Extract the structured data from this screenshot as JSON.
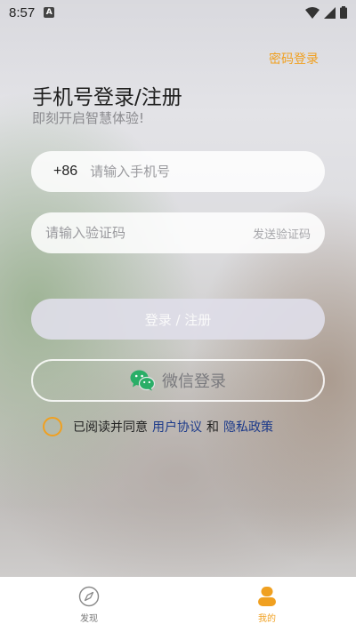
{
  "status_bar": {
    "time": "8:57",
    "notification_badge": "A",
    "icons": [
      "wifi-icon",
      "signal-icon",
      "battery-icon"
    ]
  },
  "header": {
    "password_login_label": "密码登录",
    "title": "手机号登录/注册",
    "subtitle": "即刻开启智慧体验!"
  },
  "form": {
    "country_code": "+86",
    "phone_placeholder": "请输入手机号",
    "phone_value": "",
    "code_placeholder": "请输入验证码",
    "code_value": "",
    "send_code_label": "发送验证码",
    "login_button_label": "登录 / 注册",
    "wechat_login_label": "微信登录"
  },
  "agreement": {
    "checked": false,
    "prefix_text": "已阅读并同意",
    "user_agreement_label": "用户协议",
    "and_text": "和",
    "privacy_policy_label": "隐私政策"
  },
  "tabbar": {
    "tabs": [
      {
        "label": "发现",
        "icon": "compass-icon",
        "active": false
      },
      {
        "label": "我的",
        "icon": "user-icon",
        "active": true
      }
    ]
  },
  "colors": {
    "accent": "#f0a020",
    "link": "#1c3a8a",
    "wechat_green": "#2aae67"
  }
}
